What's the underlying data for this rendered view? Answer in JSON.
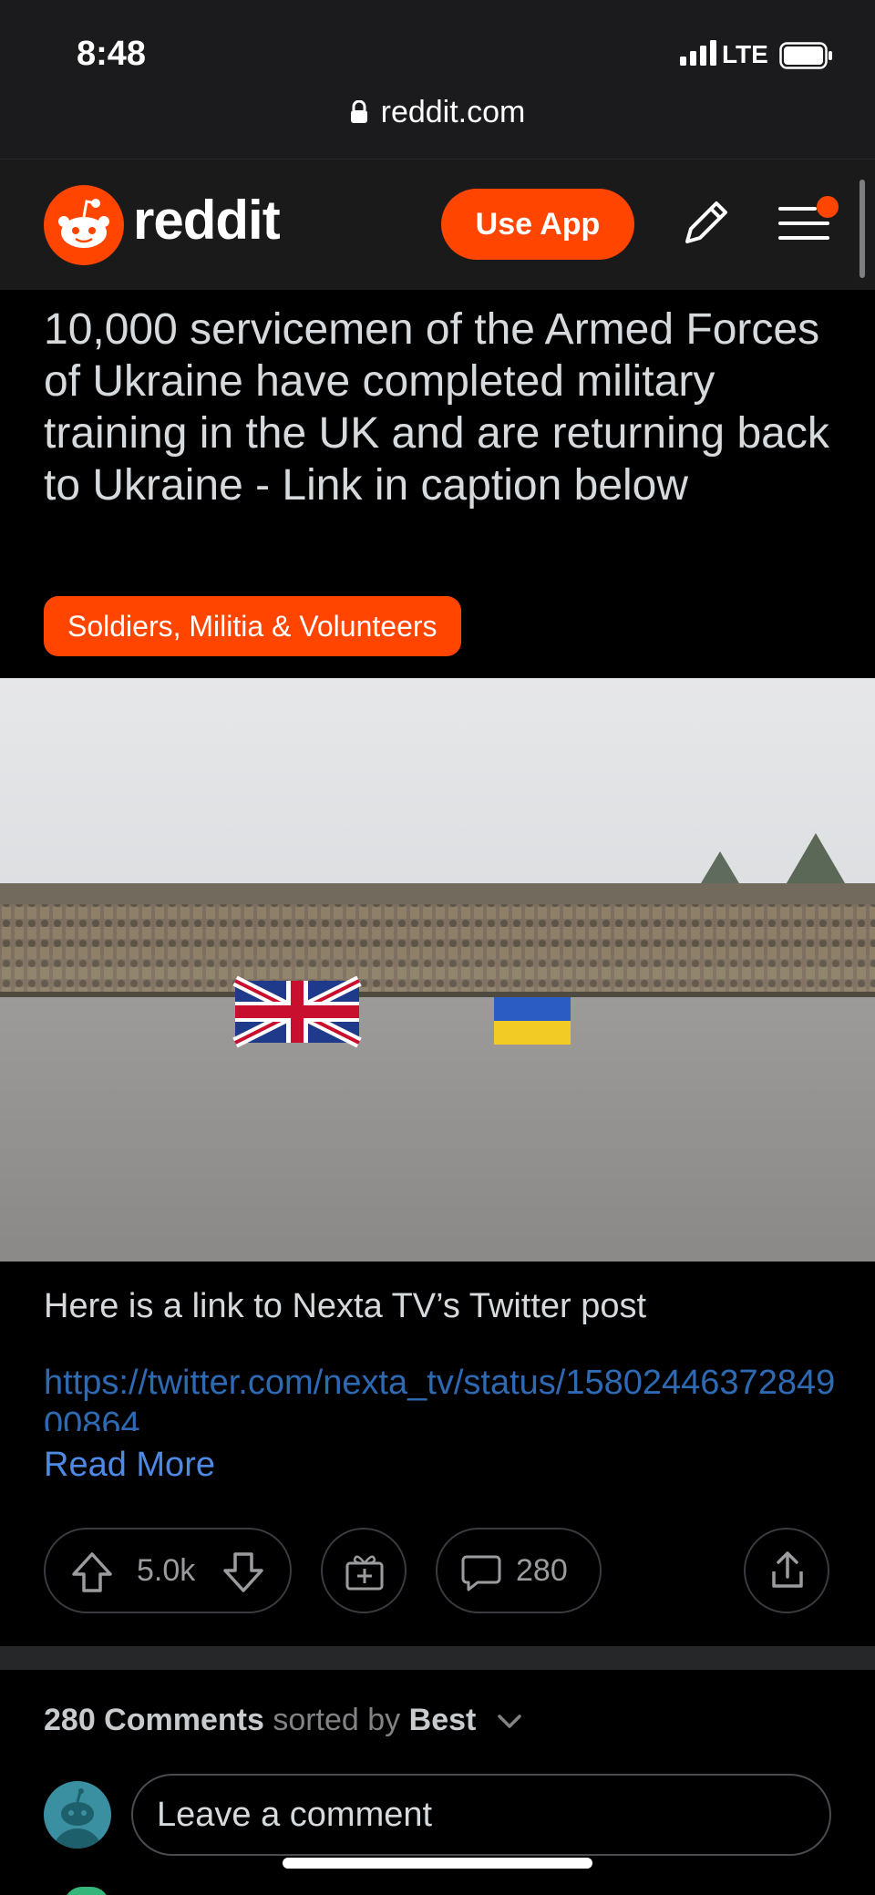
{
  "status": {
    "time": "8:48",
    "network": "LTE",
    "url": "reddit.com"
  },
  "header": {
    "wordmark": "reddit",
    "use_app_label": "Use App",
    "accent_color": "#ff4500"
  },
  "post": {
    "title": "10,000 servicemen of the Armed Forces of Ukraine have completed military training in the UK and are returning back to Ukraine - Link in caption below",
    "flair": "Soldiers, Militia & Volunteers",
    "body_text": "Here is a link to Nexta TV’s Twitter post",
    "link_text": "https://twitter.com/nexta_tv/status/1580244637284900864",
    "read_more": "Read More",
    "votes": "5.0k",
    "comments_count": "280"
  },
  "comments": {
    "count_label": "280 Comments",
    "sorted_by_label": "sorted by",
    "sort_value": "Best",
    "placeholder": "Leave a comment"
  }
}
